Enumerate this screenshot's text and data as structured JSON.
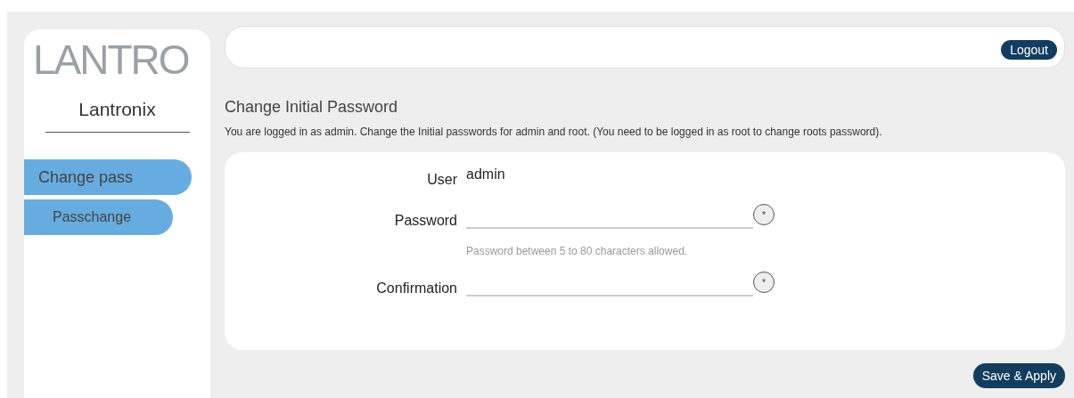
{
  "sidebar": {
    "logo": "LANTRO",
    "title": "Lantronix",
    "items": [
      {
        "label": "Change pass",
        "kind": "group"
      },
      {
        "label": "Passchange",
        "kind": "item"
      }
    ]
  },
  "topbar": {
    "logout": "Logout"
  },
  "page": {
    "title": "Change Initial Password",
    "description": "You are logged in as admin. Change the Initial passwords for admin and root. (You need to be logged in as root to change roots password)."
  },
  "form": {
    "rows": [
      {
        "kind": "static",
        "label": "User",
        "value": "admin"
      },
      {
        "kind": "password",
        "label": "Password",
        "toggle": "*",
        "hint": "Password between 5 to 80 characters allowed."
      },
      {
        "kind": "password",
        "label": "Confirmation",
        "toggle": "*"
      }
    ]
  },
  "save": "Save & Apply"
}
